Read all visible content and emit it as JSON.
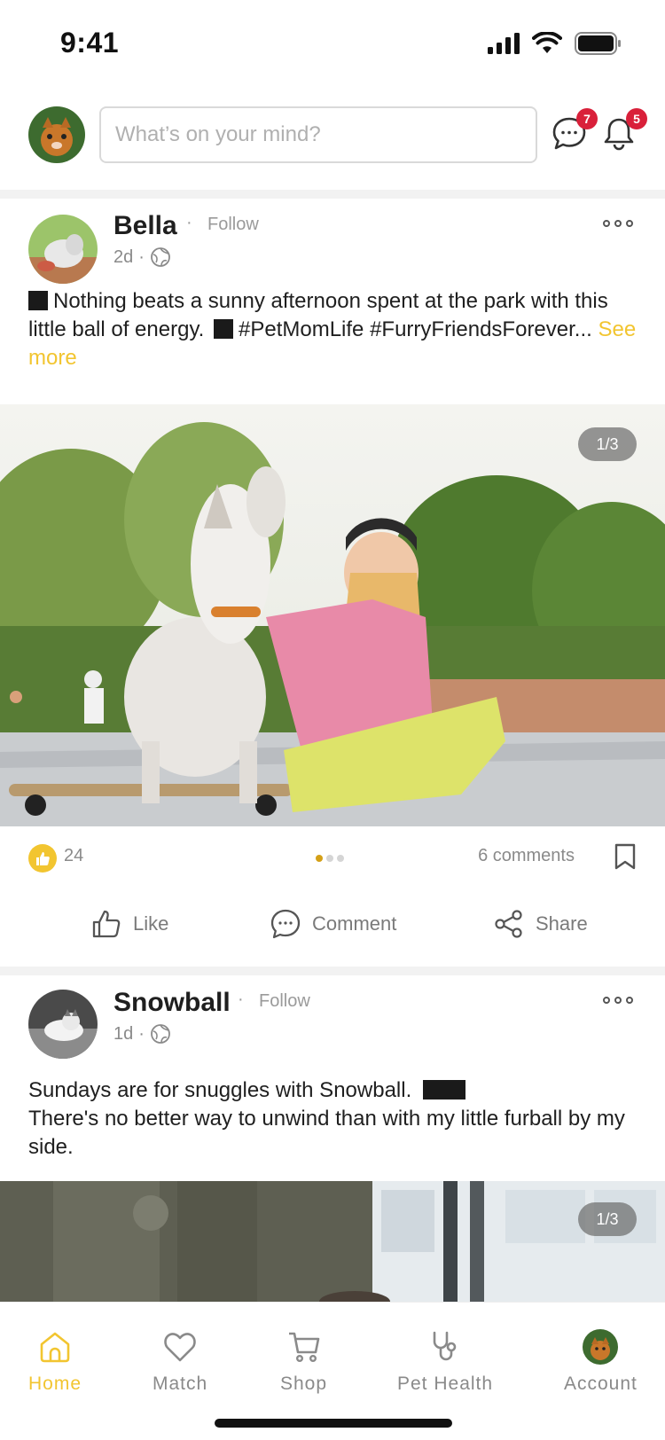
{
  "status_bar": {
    "time": "9:41"
  },
  "top_bar": {
    "search_placeholder": "What’s on your mind?",
    "messages_badge": "7",
    "notifications_badge": "5"
  },
  "posts": [
    {
      "author": "Bella",
      "follow_label": "Follow",
      "time": "2d",
      "text_line1": "Nothing beats a sunny afternoon spent at the park with this little ball of energy.",
      "text_line2": "#PetMomLife #FurryFriendsForever...",
      "see_more": "See more",
      "photo_counter": "1/3",
      "likes": "24",
      "comments": "6 comments",
      "actions": {
        "like": "Like",
        "comment": "Comment",
        "share": "Share"
      }
    },
    {
      "author": "Snowball",
      "follow_label": "Follow",
      "time": "1d",
      "text_line1": "Sundays are for snuggles with Snowball.",
      "text_line2": "There's no better way to unwind than with my little furball by my side.",
      "photo_counter": "1/3"
    }
  ],
  "bottom_nav": {
    "items": [
      {
        "label": "Home",
        "icon": "home-icon",
        "active": true
      },
      {
        "label": "Match",
        "icon": "heart-icon"
      },
      {
        "label": "Shop",
        "icon": "cart-icon"
      },
      {
        "label": "Pet Health",
        "icon": "stethoscope-icon"
      },
      {
        "label": "Account",
        "icon": "account-avatar"
      }
    ]
  },
  "colors": {
    "accent": "#F2C530",
    "badge": "#D9203A",
    "text": "#1F1F1F",
    "muted": "#8A8A8A"
  }
}
